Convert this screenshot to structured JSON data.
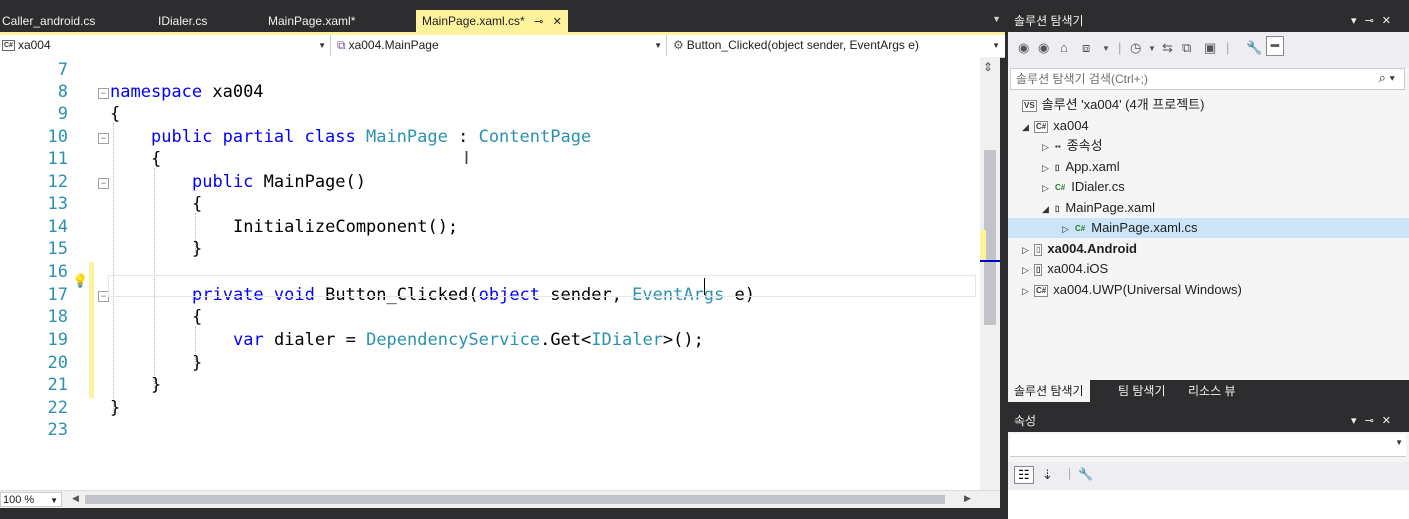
{
  "tabs": [
    {
      "label": "Caller_android.cs",
      "active": false
    },
    {
      "label": "IDialer.cs",
      "active": false
    },
    {
      "label": "MainPage.xaml*",
      "active": false
    },
    {
      "label": "MainPage.xaml.cs*",
      "active": true
    }
  ],
  "tab_pin": "⊸",
  "tab_close": "✕",
  "navbar": {
    "project_badge": "C#",
    "project": "xa004",
    "class": "xa004.MainPage",
    "member": "Button_Clicked(object sender, EventArgs e)"
  },
  "line_numbers": [
    "7",
    "8",
    "9",
    "10",
    "11",
    "12",
    "13",
    "14",
    "15",
    "16",
    "17",
    "18",
    "19",
    "20",
    "21",
    "22",
    "23"
  ],
  "code": {
    "l8_kw": "namespace",
    "l8_rest": " xa004",
    "l9": "{",
    "l10_kw1": "public",
    "l10_kw2": " partial",
    "l10_kw3": " class",
    "l10_ty1": " MainPage",
    "l10_sep": " :",
    "l10_ty2": " ContentPage",
    "l11": "{",
    "l12_kw": "public",
    "l12_rest": " MainPage()",
    "l13": "{",
    "l14": "InitializeComponent();",
    "l15": "}",
    "l17_kw1": "private",
    "l17_kw2": " void",
    "l17_m": " Button_Clicked(",
    "l17_kw3": "object",
    "l17_p1": " sender, ",
    "l17_ty": "EventArgs",
    "l17_p2": " e)",
    "l18": "{",
    "l19_kw": "var",
    "l19_a": " dialer = ",
    "l19_ty1": "DependencyService",
    "l19_b": ".Get<",
    "l19_ty2": "IDialer",
    "l19_c": ">();",
    "l20": "}",
    "l21": "}",
    "l22": "}"
  },
  "zoom": "100 %",
  "solution_explorer": {
    "title": "솔루션 탐색기",
    "search_placeholder": "솔루션 탐색기 검색(Ctrl+;)",
    "tree": [
      {
        "label": "솔루션 'xa004' (4개 프로젝트)",
        "icon": "VS",
        "arrow": "",
        "indent": 0
      },
      {
        "label": "xa004",
        "icon": "C#",
        "arrow": "◢",
        "indent": 1
      },
      {
        "label": "종속성",
        "icon": "▪▪",
        "arrow": "▷",
        "indent": 2
      },
      {
        "label": "App.xaml",
        "icon": "▯",
        "arrow": "▷",
        "indent": 2
      },
      {
        "label": "IDialer.cs",
        "icon": "C#",
        "arrow": "▷",
        "indent": 2
      },
      {
        "label": "MainPage.xaml",
        "icon": "▯",
        "arrow": "◢",
        "indent": 2
      },
      {
        "label": "MainPage.xaml.cs",
        "icon": "C#",
        "arrow": "▷",
        "indent": 3,
        "selected": true
      },
      {
        "label": "xa004.Android",
        "icon": "▯",
        "arrow": "▷",
        "indent": 0,
        "bold": true
      },
      {
        "label": "xa004.iOS",
        "icon": "▯",
        "arrow": "▷",
        "indent": 0
      },
      {
        "label": "xa004.UWP(Universal Windows)",
        "icon": "C#",
        "arrow": "▷",
        "indent": 0
      }
    ],
    "bottom_tabs": [
      "솔루션 탐색기",
      "팀 탐색기",
      "리소스 뷰"
    ]
  },
  "properties": {
    "title": "속성"
  },
  "colors": {
    "keyword": "#0000ff",
    "type": "#2b91af",
    "line_number": "#2b91af",
    "active_tab": "#fff29d",
    "chrome": "#2d2d30"
  }
}
